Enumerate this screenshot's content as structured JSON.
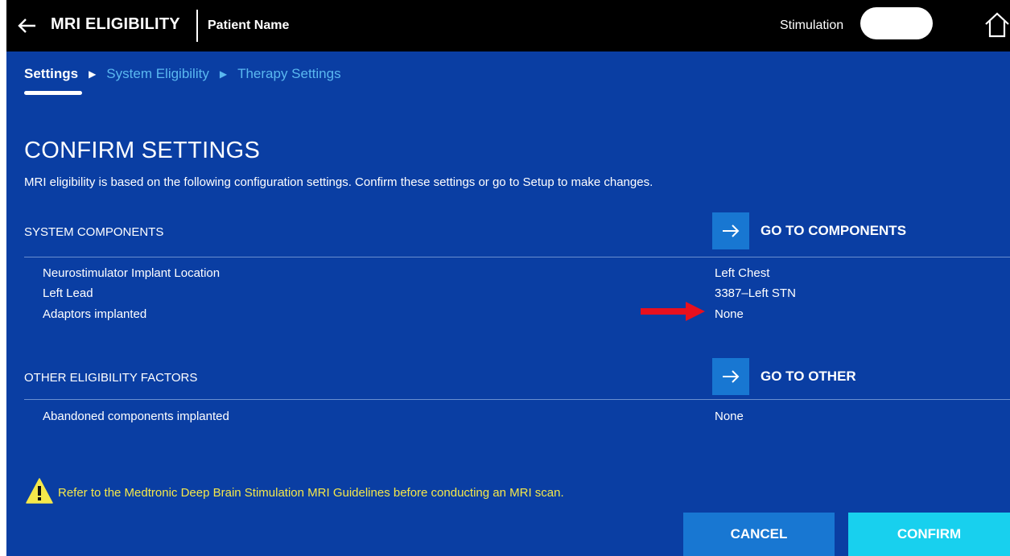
{
  "header": {
    "title": "MRI ELIGIBILITY",
    "patient_name": "Patient Name",
    "stimulation_label": "Stimulation"
  },
  "breadcrumb": {
    "items": [
      {
        "label": "Settings",
        "active": true
      },
      {
        "label": "System Eligibility",
        "active": false
      },
      {
        "label": "Therapy Settings",
        "active": false
      }
    ],
    "separator": "▶"
  },
  "main": {
    "title": "CONFIRM SETTINGS",
    "description": "MRI eligibility is based on the following configuration settings. Confirm these settings or go to Setup to make changes."
  },
  "system_components": {
    "label": "SYSTEM COMPONENTS",
    "button_label": "GO TO COMPONENTS",
    "rows": [
      {
        "label": "Neurostimulator Implant Location",
        "value": "Left Chest"
      },
      {
        "label": "Left Lead",
        "value": "3387–Left STN"
      },
      {
        "label": "Adaptors implanted",
        "value": "None"
      }
    ]
  },
  "other_factors": {
    "label": "OTHER ELIGIBILITY FACTORS",
    "button_label": "GO TO OTHER",
    "rows": [
      {
        "label": "Abandoned components implanted",
        "value": "None"
      }
    ]
  },
  "warning": {
    "text": "Refer to the Medtronic Deep Brain Stimulation MRI Guidelines before conducting an MRI scan."
  },
  "actions": {
    "cancel_label": "CANCEL",
    "confirm_label": "CONFIRM"
  },
  "icons": {
    "back": "back-arrow-icon",
    "home": "home-icon",
    "go": "arrow-right-icon",
    "warning": "warning-triangle-icon",
    "annotation": "red-arrow-icon"
  },
  "colors": {
    "background": "#0a3ea3",
    "topbar": "#000000",
    "accent_blue": "#1877d2",
    "confirm_cyan": "#18d0ee",
    "link_blue": "#5ab8f0",
    "warning_yellow": "#f5e84a",
    "annotation_red": "#e8101e"
  }
}
